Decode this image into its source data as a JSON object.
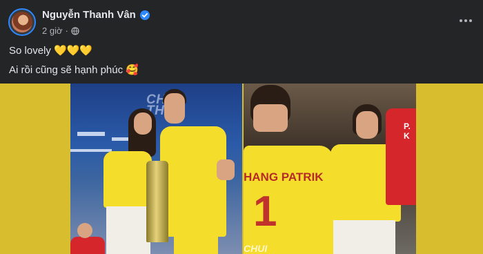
{
  "post": {
    "author": "Nguyễn Thanh Vân",
    "time": "2 giờ",
    "lines": [
      "So lovely 💛💛💛",
      "Ai rồi cũng sẽ hạnh phúc 🥰"
    ]
  },
  "media": {
    "watermark_left": "CHUI THUÉ",
    "watermark_bottom": "CHUI",
    "jersey_name": "HANG PATRIK",
    "jersey_number": "1",
    "jersey_side": "P. K"
  },
  "colors": {
    "background": "#242526",
    "accent_yellow": "#d8bd2e",
    "verified": "#2d88ff"
  },
  "icons": {
    "verified": "verified-badge-icon",
    "privacy": "globe-icon",
    "menu": "more-options-icon"
  }
}
